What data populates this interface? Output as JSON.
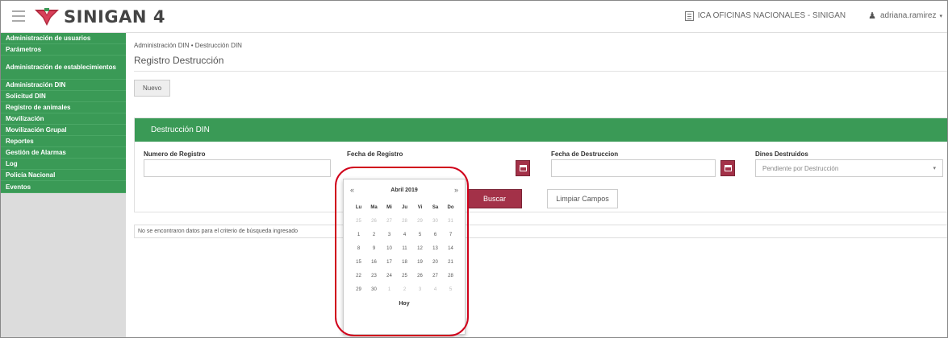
{
  "header": {
    "app_name": "SINIGAN",
    "app_version": "4",
    "office": "ICA OFICINAS NACIONALES - SINIGAN",
    "user": "adriana.ramirez"
  },
  "sidebar": {
    "items": [
      {
        "label": "Administración de usuarios"
      },
      {
        "label": "Parámetros"
      },
      {
        "label": "Administración de establecimientos"
      },
      {
        "label": "Administración DIN"
      },
      {
        "label": "Solicitud DIN"
      },
      {
        "label": "Registro de animales"
      },
      {
        "label": "Movilización"
      },
      {
        "label": "Movilización Grupal"
      },
      {
        "label": "Reportes"
      },
      {
        "label": "Gestión de Alarmas"
      },
      {
        "label": "Log"
      },
      {
        "label": "Policía Nacional"
      },
      {
        "label": "Eventos"
      }
    ]
  },
  "main": {
    "breadcrumb": "Administración DIN • Destrucción DIN",
    "page_title": "Registro Destrucción",
    "new_button": "Nuevo",
    "panel_title": "Destrucción DIN",
    "fields": {
      "numero_label": "Numero de Registro",
      "fecha_registro_label": "Fecha de Registro",
      "fecha_destruccion_label": "Fecha de Destruccion",
      "dines_label": "Dines Destruidos",
      "dines_value": "Pendiente por Destrucción"
    },
    "search_button": "Buscar",
    "clear_button": "Limpiar Campos",
    "empty_message": "No se encontraron datos para el criterio de búsqueda ingresado"
  },
  "datepicker": {
    "prev": "«",
    "next": "»",
    "month_title": "Abril 2019",
    "weekdays": [
      "Lu",
      "Ma",
      "Mi",
      "Ju",
      "Vi",
      "Sa",
      "Do"
    ],
    "weeks": [
      [
        "25",
        "26",
        "27",
        "28",
        "29",
        "30",
        "31"
      ],
      [
        "1",
        "2",
        "3",
        "4",
        "5",
        "6",
        "7"
      ],
      [
        "8",
        "9",
        "10",
        "11",
        "12",
        "13",
        "14"
      ],
      [
        "15",
        "16",
        "17",
        "18",
        "19",
        "20",
        "21"
      ],
      [
        "22",
        "23",
        "24",
        "25",
        "26",
        "27",
        "28"
      ],
      [
        "29",
        "30",
        "1",
        "2",
        "3",
        "4",
        "5"
      ]
    ],
    "muted": [
      [
        true,
        true,
        true,
        true,
        true,
        true,
        true
      ],
      [
        false,
        false,
        false,
        false,
        false,
        false,
        false
      ],
      [
        false,
        false,
        false,
        false,
        false,
        false,
        false
      ],
      [
        false,
        false,
        false,
        false,
        false,
        false,
        false
      ],
      [
        false,
        false,
        false,
        false,
        false,
        false,
        false
      ],
      [
        false,
        false,
        true,
        true,
        true,
        true,
        true
      ]
    ],
    "today_label": "Hoy"
  },
  "colors": {
    "green": "#3a9a56",
    "accent_red": "#a33148",
    "highlight_red": "#d0021b"
  }
}
